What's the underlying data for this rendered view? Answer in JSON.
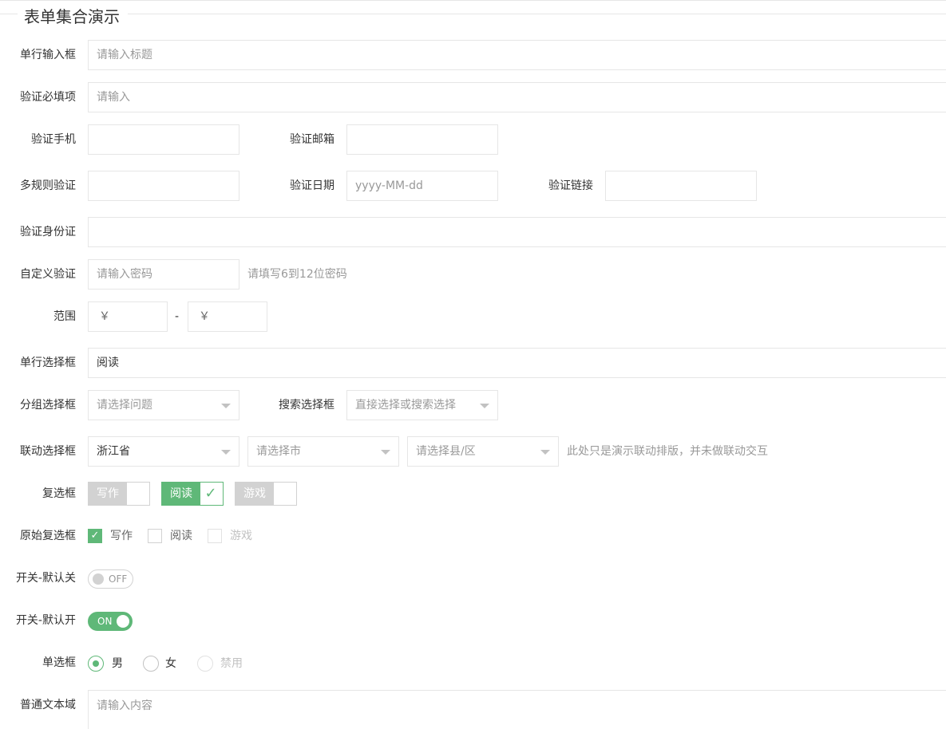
{
  "legend": "表单集合演示",
  "rows": {
    "single_input": {
      "label": "单行输入框",
      "placeholder": "请输入标题"
    },
    "required": {
      "label": "验证必填项",
      "placeholder": "请输入"
    },
    "phone": {
      "label": "验证手机",
      "value": ""
    },
    "email": {
      "label": "验证邮箱",
      "value": ""
    },
    "multi_rule": {
      "label": "多规则验证",
      "value": ""
    },
    "date": {
      "label": "验证日期",
      "placeholder": "yyyy-MM-dd"
    },
    "link": {
      "label": "验证链接",
      "value": ""
    },
    "id_card": {
      "label": "验证身份证",
      "value": ""
    },
    "custom": {
      "label": "自定义验证",
      "placeholder": "请输入密码",
      "aux": "请填写6到12位密码"
    },
    "range": {
      "label": "范围",
      "min_placeholder": "￥",
      "sep": "-",
      "max_placeholder": "￥"
    },
    "single_select": {
      "label": "单行选择框",
      "value": "阅读"
    },
    "group_select": {
      "label": "分组选择框",
      "placeholder": "请选择问题"
    },
    "search_select": {
      "label": "搜索选择框",
      "placeholder": "直接选择或搜索选择"
    },
    "linked_select": {
      "label": "联动选择框",
      "province": "浙江省",
      "city_placeholder": "请选择市",
      "county_placeholder": "请选择县/区",
      "aux": "此处只是演示联动排版，并未做联动交互"
    },
    "checkbox": {
      "label": "复选框",
      "items": [
        {
          "text": "写作",
          "checked": false
        },
        {
          "text": "阅读",
          "checked": true,
          "mark": "✓"
        },
        {
          "text": "游戏",
          "checked": false
        }
      ]
    },
    "primary_checkbox": {
      "label": "原始复选框",
      "items": [
        {
          "text": "写作",
          "checked": true,
          "mark": "✓"
        },
        {
          "text": "阅读",
          "checked": false
        },
        {
          "text": "游戏",
          "disabled": true
        }
      ]
    },
    "switch_off": {
      "label": "开关-默认关",
      "text": "OFF",
      "on": false
    },
    "switch_on": {
      "label": "开关-默认开",
      "text": "ON",
      "on": true
    },
    "radio": {
      "label": "单选框",
      "items": [
        {
          "text": "男",
          "checked": true
        },
        {
          "text": "女",
          "checked": false
        },
        {
          "text": "禁用",
          "disabled": true
        }
      ]
    },
    "textarea": {
      "label": "普通文本域",
      "placeholder": "请输入内容"
    }
  },
  "colors": {
    "accent": "#5fb878",
    "border": "#e6e6e6",
    "placeholder": "#999999"
  }
}
